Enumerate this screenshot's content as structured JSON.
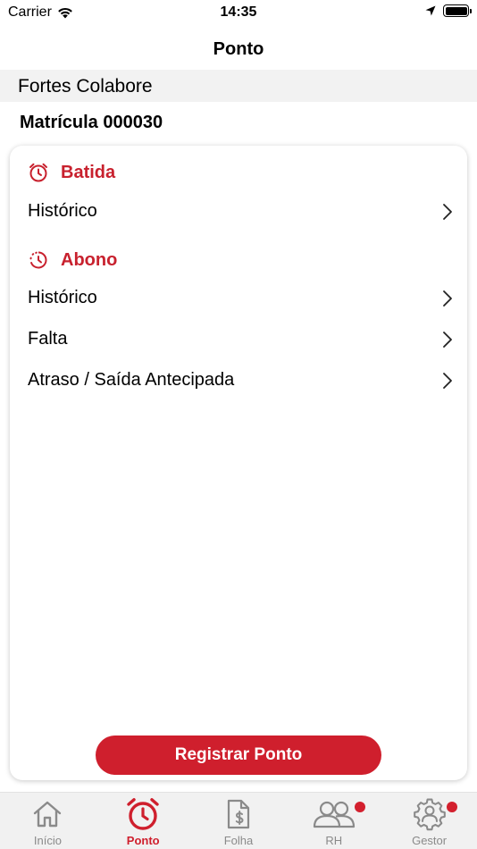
{
  "status_bar": {
    "carrier": "Carrier",
    "time": "14:35"
  },
  "nav": {
    "title": "Ponto"
  },
  "company": {
    "name": "Fortes Colabore"
  },
  "matricula": {
    "label": "Matrícula 000030"
  },
  "sections": {
    "batida": {
      "title": "Batida",
      "items": [
        "Histórico"
      ]
    },
    "abono": {
      "title": "Abono",
      "items": [
        "Histórico",
        "Falta",
        "Atraso / Saída Antecipada"
      ]
    }
  },
  "actions": {
    "registrar_label": "Registrar Ponto"
  },
  "tabs": [
    {
      "label": "Início",
      "icon": "home-icon",
      "active": false,
      "badge": false
    },
    {
      "label": "Ponto",
      "icon": "alarm-clock-icon",
      "active": true,
      "badge": false
    },
    {
      "label": "Folha",
      "icon": "payslip-icon",
      "active": false,
      "badge": false
    },
    {
      "label": "RH",
      "icon": "people-icon",
      "active": false,
      "badge": true
    },
    {
      "label": "Gestor",
      "icon": "gear-person-icon",
      "active": false,
      "badge": true
    }
  ],
  "colors": {
    "accent": "#cf1f2d",
    "tab_inactive": "#8a8a8a",
    "band": "#f2f2f2"
  }
}
